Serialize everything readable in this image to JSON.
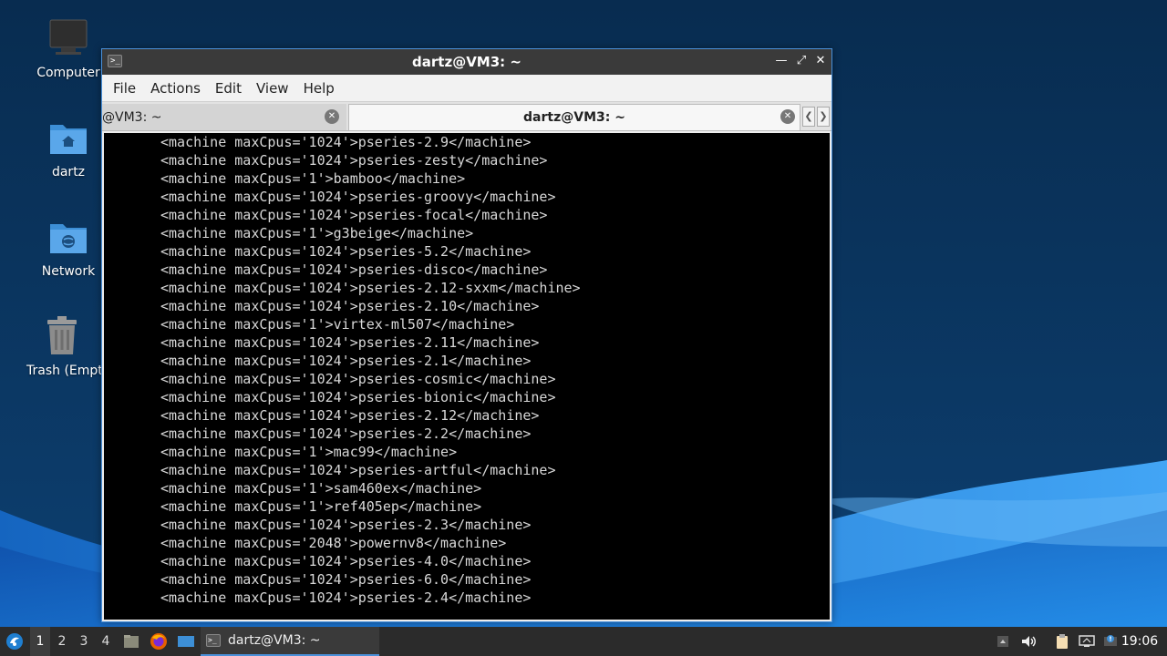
{
  "desktop": {
    "icons": [
      {
        "label": "Computer"
      },
      {
        "label": "dartz"
      },
      {
        "label": "Network"
      },
      {
        "label": "Trash (Empty)"
      }
    ]
  },
  "window": {
    "title": "dartz@VM3: ~",
    "menu": [
      "File",
      "Actions",
      "Edit",
      "View",
      "Help"
    ],
    "tabs": [
      {
        "label": "@VM3: ~",
        "active": false
      },
      {
        "label": "dartz@VM3: ~",
        "active": true
      }
    ]
  },
  "terminal": {
    "lines": [
      "<machine maxCpus='1024'>pseries-2.9</machine>",
      "<machine maxCpus='1024'>pseries-zesty</machine>",
      "<machine maxCpus='1'>bamboo</machine>",
      "<machine maxCpus='1024'>pseries-groovy</machine>",
      "<machine maxCpus='1024'>pseries-focal</machine>",
      "<machine maxCpus='1'>g3beige</machine>",
      "<machine maxCpus='1024'>pseries-5.2</machine>",
      "<machine maxCpus='1024'>pseries-disco</machine>",
      "<machine maxCpus='1024'>pseries-2.12-sxxm</machine>",
      "<machine maxCpus='1024'>pseries-2.10</machine>",
      "<machine maxCpus='1'>virtex-ml507</machine>",
      "<machine maxCpus='1024'>pseries-2.11</machine>",
      "<machine maxCpus='1024'>pseries-2.1</machine>",
      "<machine maxCpus='1024'>pseries-cosmic</machine>",
      "<machine maxCpus='1024'>pseries-bionic</machine>",
      "<machine maxCpus='1024'>pseries-2.12</machine>",
      "<machine maxCpus='1024'>pseries-2.2</machine>",
      "<machine maxCpus='1'>mac99</machine>",
      "<machine maxCpus='1024'>pseries-artful</machine>",
      "<machine maxCpus='1'>sam460ex</machine>",
      "<machine maxCpus='1'>ref405ep</machine>",
      "<machine maxCpus='1024'>pseries-2.3</machine>",
      "<machine maxCpus='2048'>powernv8</machine>",
      "<machine maxCpus='1024'>pseries-4.0</machine>",
      "<machine maxCpus='1024'>pseries-6.0</machine>",
      "<machine maxCpus='1024'>pseries-2.4</machine>"
    ]
  },
  "taskbar": {
    "workspaces": [
      "1",
      "2",
      "3",
      "4"
    ],
    "active_workspace": "1",
    "task_label": "dartz@VM3: ~",
    "clock": "19:06"
  },
  "colors": {
    "accent": "#4a90d9",
    "wallpaper_dark": "#0b3a66",
    "wallpaper_light": "#1e88e5"
  }
}
